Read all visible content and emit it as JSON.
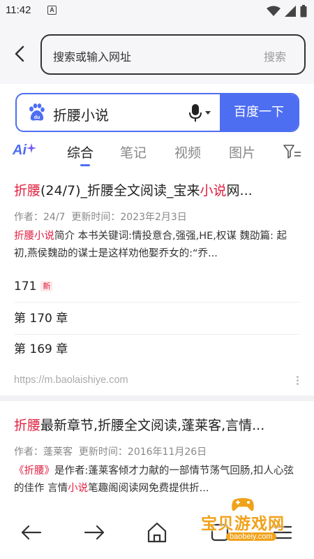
{
  "status_bar": {
    "time": "11:42",
    "notification_letter": "A"
  },
  "address_bar": {
    "placeholder": "搜索或输入网址",
    "search_label": "搜索"
  },
  "baidu": {
    "query": "折腰小说",
    "button_label": "百度一下",
    "brand_color": "#4e6ef2"
  },
  "tabs": {
    "ai_label": "Ai",
    "items": [
      "综合",
      "笔记",
      "视频",
      "图片"
    ],
    "active": "综合"
  },
  "results": [
    {
      "title_hl1": "折腰",
      "title_mid": "(24/7)_折腰全文阅读_宝来",
      "title_hl2": "小说",
      "title_tail": "网...",
      "author_label": "作者：",
      "author": "24/7",
      "updated_label": "更新时间：",
      "updated": "2023年2月3日",
      "snippet_hl": "折腰小说",
      "snippet": "简介 本书关键词:情投意合,强强,HE,权谋 魏劭篇: 起初,燕侯魏劭的谋士是这样劝他娶乔女的:“乔...",
      "chapters": [
        {
          "label": "171",
          "badge": "新"
        },
        {
          "label": "第 170 章"
        },
        {
          "label": "第 169 章"
        }
      ],
      "source": "https://m.baolaishiye.com"
    },
    {
      "title_hl1": "折腰",
      "title_mid": "最新章节,折腰全文阅读,蓬莱客,言情...",
      "author_label": "作者：",
      "author": "蓬莱客",
      "updated_label": "更新时间：",
      "updated": "2016年11月26日",
      "snippet_hl": "《折腰》",
      "snippet_a": "是作者:蓬莱客倾才力献的一部情节荡气回肠,扣人心弦的佳作 言情",
      "snippet_hl2": "小说",
      "snippet_b": "笔趣阁阅读网免费提供折..."
    }
  ],
  "bottom_nav": [
    "back-arrow-icon",
    "forward-arrow-icon",
    "home-icon",
    "tabs-icon",
    "menu-icon"
  ],
  "watermark": {
    "text": "宝贝游戏网",
    "url": "baobeiy.com"
  },
  "colors": {
    "highlight": "#e0203f",
    "accent": "#4e6ef2",
    "watermark": "#f0a21a"
  }
}
